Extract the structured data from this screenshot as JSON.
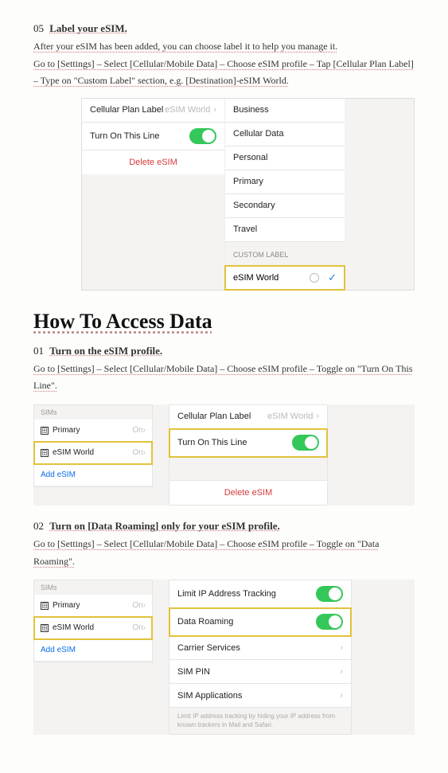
{
  "step05": {
    "num": "05",
    "title": "Label your eSIM.",
    "line1": "After your eSIM has been added, you can choose label it to help you manage it.",
    "line2": "Go to [Settings] – Select [Cellular/Mobile Data] – Choose eSIM profile – Tap [Cellular Plan Label] – Type on \"Custom Label\" section, e.g. [Destination]-eSIM World."
  },
  "fig05": {
    "left": {
      "plan_label": "Cellular Plan Label",
      "plan_value": "eSIM World",
      "turn_on": "Turn On This Line",
      "delete": "Delete eSIM"
    },
    "right": {
      "options": [
        "Business",
        "Cellular Data",
        "Personal",
        "Primary",
        "Secondary",
        "Travel"
      ],
      "custom_header": "CUSTOM LABEL",
      "input_value": "eSIM World"
    }
  },
  "section_title": "How To Access Data",
  "step01a": {
    "num": "01",
    "title": "Turn on the eSIM profile.",
    "line": "Go to [Settings] – Select [Cellular/Mobile Data] – Choose eSIM profile – Toggle on \"Turn On This Line\"."
  },
  "sim_panel": {
    "header": "SIMs",
    "primary": "Primary",
    "esim": "eSIM World",
    "on": "On",
    "add": "Add eSIM"
  },
  "cell_panel": {
    "plan_label": "Cellular Plan Label",
    "plan_value": "eSIM World",
    "turn_on": "Turn On This Line",
    "delete": "Delete eSIM"
  },
  "step02a": {
    "num": "02",
    "title": "Turn on [Data Roaming] only for your eSIM profile.",
    "line": "Go to [Settings] – Select [Cellular/Mobile Data] – Choose eSIM profile – Toggle on \"Data Roaming\"."
  },
  "roam_panel": {
    "limit": "Limit IP Address Tracking",
    "data_roaming": "Data Roaming",
    "carrier": "Carrier Services",
    "simpin": "SIM PIN",
    "simapps": "SIM Applications",
    "foot": "Limit IP address tracking by hiding your IP address from known trackers in Mail and Safari."
  }
}
